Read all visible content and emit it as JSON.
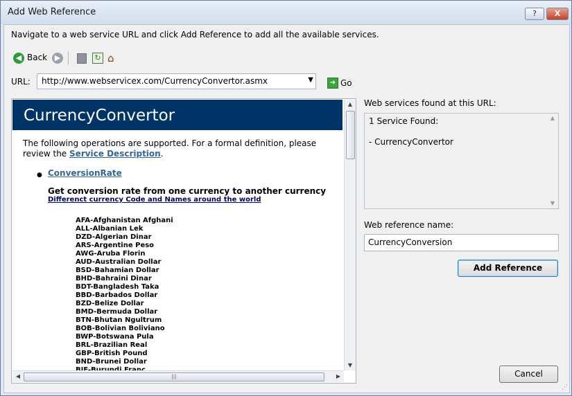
{
  "window": {
    "title": "Add Web Reference",
    "help_label": "?",
    "close_label": "X"
  },
  "instruction": "Navigate to a web service URL and click Add Reference to add all the available services.",
  "toolbar": {
    "back_label": "Back",
    "icons": [
      "back-icon",
      "forward-icon",
      "stop-icon",
      "refresh-icon",
      "home-icon"
    ]
  },
  "url": {
    "label": "URL:",
    "value": "http://www.webservicex.com/CurrencyConvertor.asmx",
    "go_label": "Go"
  },
  "page": {
    "heading": "CurrencyConvertor",
    "intro_text": "The following operations are supported. For a formal definition, please review the",
    "service_description_link": "Service Description",
    "intro_end": ".",
    "operation_link": "ConversionRate",
    "operation_desc": "Get conversion rate from one currency to another currency",
    "codes_link": "Differenct currency Code and Names around the world",
    "currency_codes": [
      "AFA-Afghanistan Afghani",
      "ALL-Albanian Lek",
      "DZD-Algerian Dinar",
      "ARS-Argentine Peso",
      "AWG-Aruba Florin",
      "AUD-Australian Dollar",
      "BSD-Bahamian Dollar",
      "BHD-Bahraini Dinar",
      "BDT-Bangladesh Taka",
      "BBD-Barbados Dollar",
      "BZD-Belize Dollar",
      "BMD-Bermuda Dollar",
      "BTN-Bhutan Ngultrum",
      "BOB-Bolivian Boliviano",
      "BWP-Botswana Pula",
      "BRL-Brazilian Real",
      "GBP-British Pound",
      "BND-Brunei Dollar",
      "BIF-Burundi Franc"
    ]
  },
  "found": {
    "label": "Web services found at this URL:",
    "count_text": "1 Service Found:",
    "service_item": "- CurrencyConvertor"
  },
  "reference": {
    "name_label": "Web reference name:",
    "name_value": "CurrencyConversion",
    "add_button": "Add Reference",
    "cancel_button": "Cancel"
  },
  "colors": {
    "heading_bar": "#003366",
    "link": "#336699"
  }
}
